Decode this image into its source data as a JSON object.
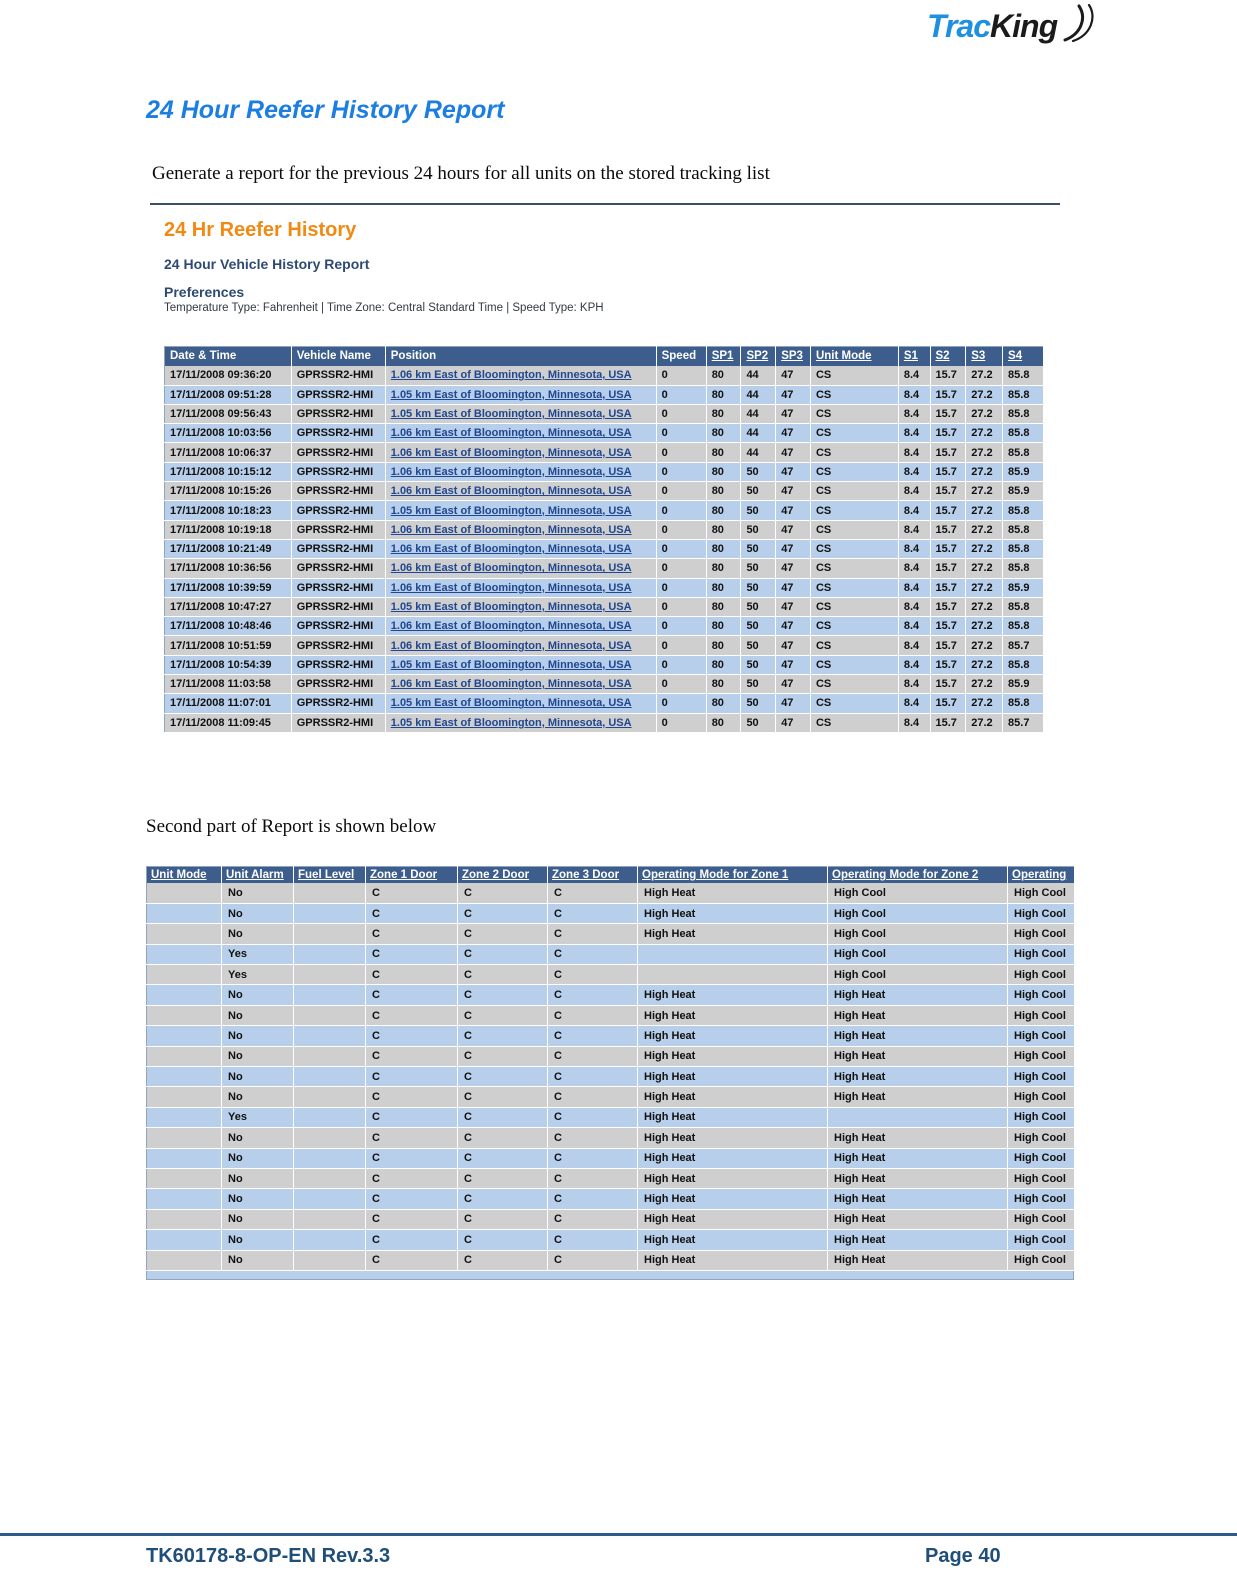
{
  "brand": {
    "logo_part1": "Trac",
    "logo_part2": "K",
    "logo_part3": "ing",
    "blue_hex": "#1f8fe0",
    "dark_hex": "#1b1b1b"
  },
  "page": {
    "title": "24 Hour Reefer History Report",
    "title_color": "#1b7ee0",
    "intro": "Generate a report for the previous 24 hours for all units on the stored tracking list",
    "mid_note": "Second part of Report is shown below"
  },
  "report": {
    "heading": "24 Hr Reefer History",
    "heading_color": "#f08a12",
    "subheading": "24 Hour Vehicle History Report",
    "preferences_label": "Preferences",
    "preferences_value": "Temperature Type: Fahrenheit | Time Zone: Central Standard Time | Speed Type: KPH",
    "header_bg": "#3d5e8c",
    "row_even_bg": "#cfcfcf",
    "row_odd_bg": "#b7cfeb"
  },
  "table1": {
    "columns": [
      "Date & Time",
      "Vehicle Name",
      "Position",
      "Speed",
      "SP1",
      "SP2",
      "SP3",
      "Unit Mode",
      "S1",
      "S2",
      "S3",
      "S4"
    ],
    "rows": [
      [
        "17/11/2008 09:36:20",
        "GPRSSR2-HMI",
        "1.06 km East of Bloomington, Minnesota, USA",
        "0",
        "80",
        "44",
        "47",
        "CS",
        "8.4",
        "15.7",
        "27.2",
        "85.8"
      ],
      [
        "17/11/2008 09:51:28",
        "GPRSSR2-HMI",
        "1.05 km East of Bloomington, Minnesota, USA",
        "0",
        "80",
        "44",
        "47",
        "CS",
        "8.4",
        "15.7",
        "27.2",
        "85.8"
      ],
      [
        "17/11/2008 09:56:43",
        "GPRSSR2-HMI",
        "1.05 km East of Bloomington, Minnesota, USA",
        "0",
        "80",
        "44",
        "47",
        "CS",
        "8.4",
        "15.7",
        "27.2",
        "85.8"
      ],
      [
        "17/11/2008 10:03:56",
        "GPRSSR2-HMI",
        "1.06 km East of Bloomington, Minnesota, USA",
        "0",
        "80",
        "44",
        "47",
        "CS",
        "8.4",
        "15.7",
        "27.2",
        "85.8"
      ],
      [
        "17/11/2008 10:06:37",
        "GPRSSR2-HMI",
        "1.06 km East of Bloomington, Minnesota, USA",
        "0",
        "80",
        "44",
        "47",
        "CS",
        "8.4",
        "15.7",
        "27.2",
        "85.8"
      ],
      [
        "17/11/2008 10:15:12",
        "GPRSSR2-HMI",
        "1.06 km East of Bloomington, Minnesota, USA",
        "0",
        "80",
        "50",
        "47",
        "CS",
        "8.4",
        "15.7",
        "27.2",
        "85.9"
      ],
      [
        "17/11/2008 10:15:26",
        "GPRSSR2-HMI",
        "1.06 km East of Bloomington, Minnesota, USA",
        "0",
        "80",
        "50",
        "47",
        "CS",
        "8.4",
        "15.7",
        "27.2",
        "85.9"
      ],
      [
        "17/11/2008 10:18:23",
        "GPRSSR2-HMI",
        "1.05 km East of Bloomington, Minnesota, USA",
        "0",
        "80",
        "50",
        "47",
        "CS",
        "8.4",
        "15.7",
        "27.2",
        "85.8"
      ],
      [
        "17/11/2008 10:19:18",
        "GPRSSR2-HMI",
        "1.06 km East of Bloomington, Minnesota, USA",
        "0",
        "80",
        "50",
        "47",
        "CS",
        "8.4",
        "15.7",
        "27.2",
        "85.8"
      ],
      [
        "17/11/2008 10:21:49",
        "GPRSSR2-HMI",
        "1.06 km East of Bloomington, Minnesota, USA",
        "0",
        "80",
        "50",
        "47",
        "CS",
        "8.4",
        "15.7",
        "27.2",
        "85.8"
      ],
      [
        "17/11/2008 10:36:56",
        "GPRSSR2-HMI",
        "1.06 km East of Bloomington, Minnesota, USA",
        "0",
        "80",
        "50",
        "47",
        "CS",
        "8.4",
        "15.7",
        "27.2",
        "85.8"
      ],
      [
        "17/11/2008 10:39:59",
        "GPRSSR2-HMI",
        "1.06 km East of Bloomington, Minnesota, USA",
        "0",
        "80",
        "50",
        "47",
        "CS",
        "8.4",
        "15.7",
        "27.2",
        "85.9"
      ],
      [
        "17/11/2008 10:47:27",
        "GPRSSR2-HMI",
        "1.05 km East of Bloomington, Minnesota, USA",
        "0",
        "80",
        "50",
        "47",
        "CS",
        "8.4",
        "15.7",
        "27.2",
        "85.8"
      ],
      [
        "17/11/2008 10:48:46",
        "GPRSSR2-HMI",
        "1.06 km East of Bloomington, Minnesota, USA",
        "0",
        "80",
        "50",
        "47",
        "CS",
        "8.4",
        "15.7",
        "27.2",
        "85.8"
      ],
      [
        "17/11/2008 10:51:59",
        "GPRSSR2-HMI",
        "1.06 km East of Bloomington, Minnesota, USA",
        "0",
        "80",
        "50",
        "47",
        "CS",
        "8.4",
        "15.7",
        "27.2",
        "85.7"
      ],
      [
        "17/11/2008 10:54:39",
        "GPRSSR2-HMI",
        "1.05 km East of Bloomington, Minnesota, USA",
        "0",
        "80",
        "50",
        "47",
        "CS",
        "8.4",
        "15.7",
        "27.2",
        "85.8"
      ],
      [
        "17/11/2008 11:03:58",
        "GPRSSR2-HMI",
        "1.06 km East of Bloomington, Minnesota, USA",
        "0",
        "80",
        "50",
        "47",
        "CS",
        "8.4",
        "15.7",
        "27.2",
        "85.9"
      ],
      [
        "17/11/2008 11:07:01",
        "GPRSSR2-HMI",
        "1.05 km East of Bloomington, Minnesota, USA",
        "0",
        "80",
        "50",
        "47",
        "CS",
        "8.4",
        "15.7",
        "27.2",
        "85.8"
      ],
      [
        "17/11/2008 11:09:45",
        "GPRSSR2-HMI",
        "1.05 km East of Bloomington, Minnesota, USA",
        "0",
        "80",
        "50",
        "47",
        "CS",
        "8.4",
        "15.7",
        "27.2",
        "85.7"
      ]
    ]
  },
  "table2": {
    "columns": [
      "Unit Mode",
      "Unit Alarm",
      "Fuel Level",
      "Zone 1 Door",
      "Zone 2 Door",
      "Zone 3 Door",
      "Operating Mode for Zone 1",
      "Operating Mode for Zone 2",
      "Operating"
    ],
    "rows": [
      [
        "",
        "No",
        "",
        "C",
        "C",
        "C",
        "High Heat",
        "High Cool",
        "High Cool"
      ],
      [
        "",
        "No",
        "",
        "C",
        "C",
        "C",
        "High Heat",
        "High Cool",
        "High Cool"
      ],
      [
        "",
        "No",
        "",
        "C",
        "C",
        "C",
        "High Heat",
        "High Cool",
        "High Cool"
      ],
      [
        "",
        "Yes",
        "",
        "C",
        "C",
        "C",
        "",
        "High Cool",
        "High Cool"
      ],
      [
        "",
        "Yes",
        "",
        "C",
        "C",
        "C",
        "",
        "High Cool",
        "High Cool"
      ],
      [
        "",
        "No",
        "",
        "C",
        "C",
        "C",
        "High Heat",
        "High Heat",
        "High Cool"
      ],
      [
        "",
        "No",
        "",
        "C",
        "C",
        "C",
        "High Heat",
        "High Heat",
        "High Cool"
      ],
      [
        "",
        "No",
        "",
        "C",
        "C",
        "C",
        "High Heat",
        "High Heat",
        "High Cool"
      ],
      [
        "",
        "No",
        "",
        "C",
        "C",
        "C",
        "High Heat",
        "High Heat",
        "High Cool"
      ],
      [
        "",
        "No",
        "",
        "C",
        "C",
        "C",
        "High Heat",
        "High Heat",
        "High Cool"
      ],
      [
        "",
        "No",
        "",
        "C",
        "C",
        "C",
        "High Heat",
        "High Heat",
        "High Cool"
      ],
      [
        "",
        "Yes",
        "",
        "C",
        "C",
        "C",
        "High Heat",
        "",
        "High Cool"
      ],
      [
        "",
        "No",
        "",
        "C",
        "C",
        "C",
        "High Heat",
        "High Heat",
        "High Cool"
      ],
      [
        "",
        "No",
        "",
        "C",
        "C",
        "C",
        "High Heat",
        "High Heat",
        "High Cool"
      ],
      [
        "",
        "No",
        "",
        "C",
        "C",
        "C",
        "High Heat",
        "High Heat",
        "High Cool"
      ],
      [
        "",
        "No",
        "",
        "C",
        "C",
        "C",
        "High Heat",
        "High Heat",
        "High Cool"
      ],
      [
        "",
        "No",
        "",
        "C",
        "C",
        "C",
        "High Heat",
        "High Heat",
        "High Cool"
      ],
      [
        "",
        "No",
        "",
        "C",
        "C",
        "C",
        "High Heat",
        "High Heat",
        "High Cool"
      ],
      [
        "",
        "No",
        "",
        "C",
        "C",
        "C",
        "High Heat",
        "High Heat",
        "High Cool"
      ]
    ]
  },
  "footer": {
    "doc_code": "TK60178-8-OP-EN Rev.3.3",
    "page_label": "Page  40",
    "rule_color": "#2e5a8e"
  }
}
